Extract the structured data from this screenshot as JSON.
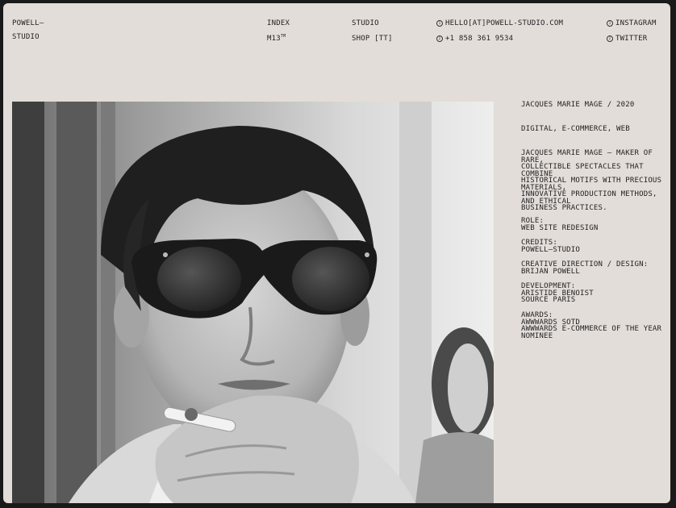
{
  "brand": {
    "line1": "POWELL—",
    "line2": "STUDIO"
  },
  "nav": {
    "index": "INDEX",
    "m13": "M13",
    "m13_sup": "TM",
    "studio": "STUDIO",
    "shop": "SHOP [TT]"
  },
  "contact": {
    "email_num": "1",
    "email": "HELLO[AT]POWELL-STUDIO.COM",
    "phone_num": "2",
    "phone": "+1 858 361 9534"
  },
  "social": {
    "instagram_num": "1",
    "instagram": "INSTAGRAM",
    "twitter_num": "2",
    "twitter": "TWITTER"
  },
  "project": {
    "title": "JACQUES MARIE MAGE / 2020",
    "categories": "DIGITAL, E-COMMERCE, WEB",
    "description": "JACQUES MARIE MAGE — MAKER OF RARE,\nCOLLECTIBLE SPECTACLES THAT COMBINE\nHISTORICAL MOTIFS WITH PRECIOUS MATERIALS,\nINNOVATIVE PRODUCTION METHODS, AND ETHICAL\nBUSINESS PRACTICES.",
    "role_label": "ROLE:",
    "role": "WEB SITE REDESIGN",
    "credits_label": "CREDITS:",
    "credits": "POWELL—STUDIO",
    "creative_label": "CREATIVE DIRECTION / DESIGN:",
    "creative": "BRIJAN POWELL",
    "development_label": "DEVELOPMENT:",
    "development": "ARISTIDE BENOIST\nSOURCE PARIS",
    "awards_label": "AWARDS:",
    "awards": "AWWWARDS SOTD\nAWWWARDS E-COMMERCE OF THE YEAR NOMINEE"
  },
  "colors": {
    "background": "#e3ddd9",
    "text": "#222222",
    "outer": "#1a1a1a"
  }
}
